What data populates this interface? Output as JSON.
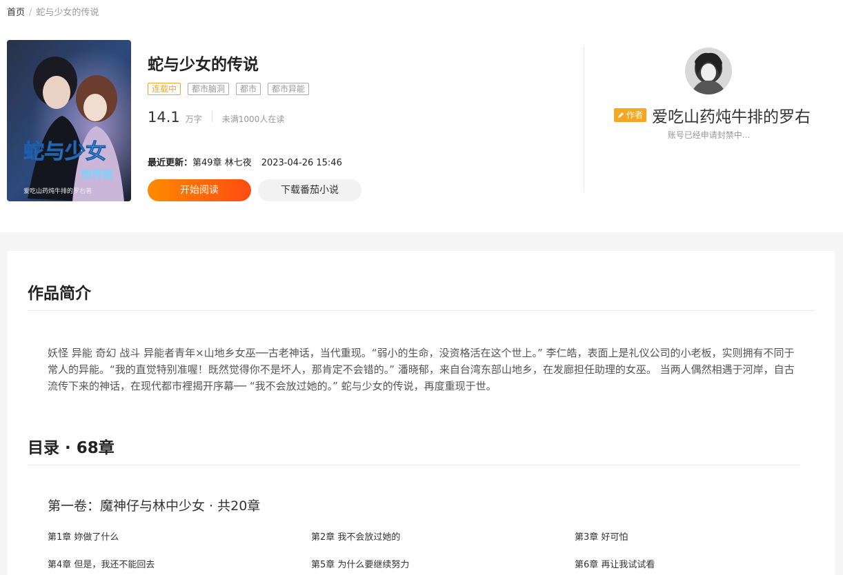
{
  "breadcrumb": {
    "home": "首页",
    "separator": "/",
    "current": "蛇与少女的传说"
  },
  "book": {
    "cover": {
      "title_art": "蛇与少女",
      "subtitle_art": "的传说",
      "author_art": "爱吃山药炖牛排的罗右著"
    },
    "title": "蛇与少女的传说",
    "tags": [
      "连载中",
      "都市脑洞",
      "都市",
      "都市异能"
    ],
    "word_count": "14.1",
    "word_unit": "万字",
    "readers": "未满1000人在读",
    "update_label": "最近更新：",
    "update_chapter": "第49章 林七夜",
    "update_time": "2023-04-26 15:46",
    "read_button": "开始阅读",
    "download_button": "下载番茄小说"
  },
  "author": {
    "badge": "作者",
    "name": "爱吃山药炖牛排的罗右",
    "note": "账号已经申请封禁中..."
  },
  "intro": {
    "heading": "作品简介",
    "text": "妖怪 异能 奇幻 战斗 异能者青年×山地乡女巫──古老神话，当代重现。“弱小的生命，没资格活在这个世上。” 李仁皓，表面上是礼仪公司的小老板，实则拥有不同于常人的异能。“我的直觉特别准喔！既然觉得你不是坏人，那肯定不会错的。” 潘晓郁，来自台湾东部山地乡，在发廊担任助理的女巫。 当两人偶然相遇于河岸，自古流传下来的神话，在现代都市裡揭开序幕── “我不会放过她的。” 蛇与少女的传说，再度重现于世。"
  },
  "toc": {
    "heading": "目录 · 68章",
    "volume": "第一卷：魔神仔与林中少女 · 共20章",
    "chapters": [
      "第1章 妳做了什么",
      "第2章 我不会放过她的",
      "第3章 好可怕",
      "第4章 但是，我还不能回去",
      "第5章 为什么要继续努力",
      "第6章 再让我试试看"
    ]
  },
  "colors": {
    "accent": "#f5a623",
    "button_start": "#ff8a00",
    "button_end": "#fe4c12"
  }
}
